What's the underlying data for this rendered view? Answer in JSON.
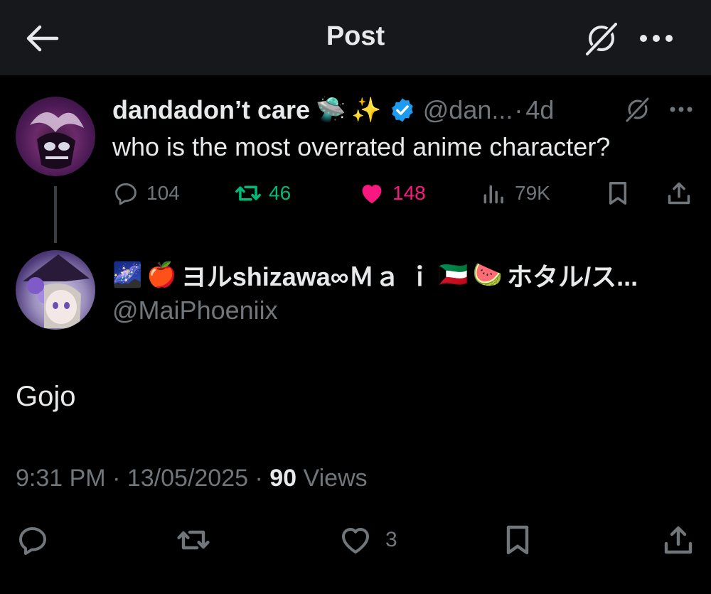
{
  "header": {
    "title": "Post",
    "back_icon": "arrow-left-icon",
    "grok_icon": "grok-icon",
    "more_icon": "more-horizontal-icon"
  },
  "original_post": {
    "display_name": "dandadon’t care",
    "emojis": [
      "🛸",
      "✨"
    ],
    "verified": true,
    "handle": "@dan...",
    "separator": "·",
    "age": "4d",
    "text": "who is the most overrated anime character?",
    "stats": {
      "replies": "104",
      "reposts": "46",
      "likes": "148",
      "views": "79K"
    }
  },
  "reply": {
    "display_name_prefix_emojis": [
      "🌌",
      "🍎"
    ],
    "display_name": "ヨルshizawa∞Ｍａ ｉ",
    "display_name_suffix_emojis": [
      "🇰🇼",
      "🍉"
    ],
    "display_name_tail": "ホタル/ス...",
    "handle": "@MaiPhoeniix",
    "text": "Gojo",
    "time": "9:31 PM",
    "date": "13/05/2025",
    "dot": "·",
    "views_count": "90",
    "views_label": "Views",
    "likes": "3"
  },
  "colors": {
    "background": "#000000",
    "header_background": "#16181c",
    "text": "#e7e9ea",
    "secondary": "#71767b",
    "repost_active": "#00ba7c",
    "like_active": "#f91880",
    "verified": "#1d9bf0"
  }
}
